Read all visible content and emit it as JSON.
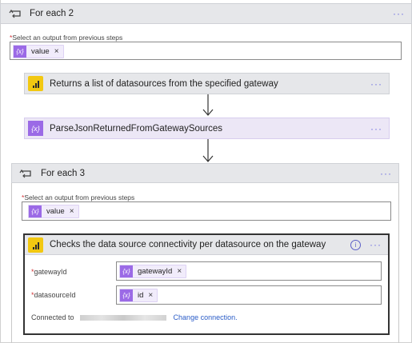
{
  "for_each_2": {
    "title": "For each 2",
    "select_label": "Select an output from previous steps",
    "required_mark": "*",
    "token": "value",
    "token_icon": "expression-icon"
  },
  "gateway_action": {
    "title": "Returns a list of datasources from the specified gateway",
    "icon": "power-bi-icon"
  },
  "parse_json_action": {
    "title": "ParseJsonReturnedFromGatewaySources",
    "icon": "expression-icon"
  },
  "for_each_3": {
    "title": "For each 3",
    "select_label": "Select an output from previous steps",
    "required_mark": "*",
    "token": "value"
  },
  "check_action": {
    "title": "Checks the data source connectivity per datasource on the gateway",
    "icon": "power-bi-icon",
    "fields": [
      {
        "label": "gatewayId",
        "token": "gatewayId"
      },
      {
        "label": "datasourceId",
        "token": "id"
      }
    ],
    "connected_to": "Connected to",
    "change_connection": "Change connection."
  },
  "more_label": "···",
  "remove_label": "×",
  "info_label": "i",
  "colors": {
    "accent": "#5b5fc7",
    "expression": "#9b6ae6",
    "power_bi": "#f2c811",
    "required": "#d13438"
  }
}
